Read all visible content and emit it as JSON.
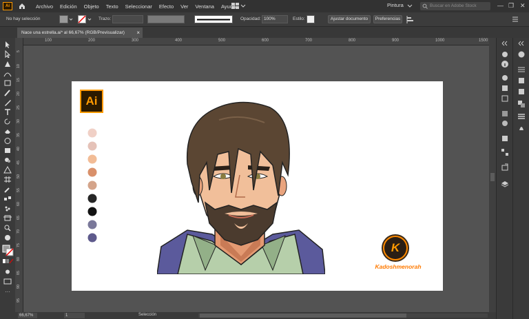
{
  "app": {
    "logo_text": "Ai",
    "menu": [
      "Archivo",
      "Edición",
      "Objeto",
      "Texto",
      "Seleccionar",
      "Efecto",
      "Ver",
      "Ventana",
      "Ayuda"
    ],
    "workspace": "Pintura",
    "stock_placeholder": "Buscar en Adobe Stock"
  },
  "control_bar": {
    "selection_text": "No hay selección",
    "stroke_label": "Trazo:",
    "opacity_label": "Opacidad:",
    "opacity_value": "100%",
    "style_label": "Estilo:",
    "adjust_button": "Ajustar documento",
    "prefs_button": "Preferencias"
  },
  "document_tab": {
    "title": "Nace una estrella.ai* al 66,67% (RGB/Previsualizar)",
    "close": "×"
  },
  "ruler": {
    "h_ticks": [
      "100",
      "150",
      "200",
      "250",
      "300",
      "350",
      "400",
      "450",
      "500",
      "550",
      "600",
      "650",
      "700",
      "750",
      "800",
      "850",
      "900",
      "950",
      "1000",
      "1050",
      "1100",
      "1150",
      "1200",
      "1250",
      "1300",
      "1350",
      "1400",
      "1450",
      "1500"
    ],
    "v_ticks": [
      "5",
      "10",
      "15",
      "20",
      "25",
      "30",
      "35",
      "40",
      "45",
      "50",
      "55",
      "60",
      "65",
      "70",
      "75",
      "80",
      "85",
      "90",
      "95"
    ]
  },
  "artboard": {
    "ai_badge_text": "Ai",
    "logo_letter": "K",
    "signature": "Kadoshmenorah",
    "palette": [
      "#f0d0c6",
      "#e5c2b8",
      "#f2bc96",
      "#d9906a",
      "#d4a48a",
      "#262626",
      "#121212",
      "#7a789a",
      "#5e5a8c"
    ]
  },
  "status_bar": {
    "zoom": "66,67%",
    "artboard_number": "1",
    "status": "Selección"
  },
  "colors": {
    "accent": "#ff9a00",
    "ui_dark": "#323232",
    "canvas": "#535353"
  }
}
